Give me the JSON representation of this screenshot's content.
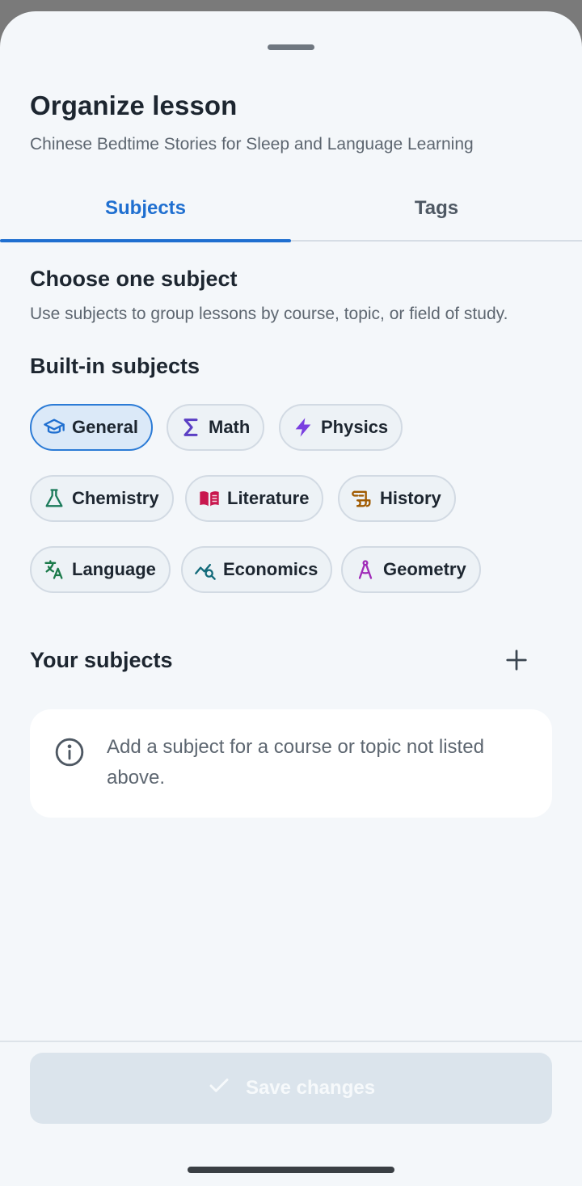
{
  "sheet": {
    "title": "Organize lesson",
    "subtitle": "Chinese Bedtime Stories for Sleep and Language Learning"
  },
  "tabs": [
    {
      "label": "Subjects",
      "active": true
    },
    {
      "label": "Tags",
      "active": false
    }
  ],
  "choose": {
    "title": "Choose one subject",
    "description": "Use subjects to group lessons by course, topic, or field of study."
  },
  "builtin": {
    "title": "Built-in subjects",
    "subjects": [
      {
        "label": "General",
        "icon": "graduation-cap-icon",
        "color": "#1f6fd0",
        "selected": true
      },
      {
        "label": "Math",
        "icon": "sigma-icon",
        "color": "#5b3fc4",
        "selected": false
      },
      {
        "label": "Physics",
        "icon": "lightning-icon",
        "color": "#7a3fe0",
        "selected": false
      },
      {
        "label": "Chemistry",
        "icon": "flask-icon",
        "color": "#1b7a5a",
        "selected": false
      },
      {
        "label": "Literature",
        "icon": "open-book-icon",
        "color": "#c8174e",
        "selected": false
      },
      {
        "label": "History",
        "icon": "scroll-icon",
        "color": "#a05a00",
        "selected": false
      },
      {
        "label": "Language",
        "icon": "translate-icon",
        "color": "#1b7a4a",
        "selected": false
      },
      {
        "label": "Economics",
        "icon": "trend-search-icon",
        "color": "#126a7a",
        "selected": false
      },
      {
        "label": "Geometry",
        "icon": "compass-icon",
        "color": "#a02ab8",
        "selected": false
      }
    ]
  },
  "yours": {
    "title": "Your subjects",
    "add_icon": "plus-icon",
    "empty_text": "Add a subject for a course or topic not listed above."
  },
  "footer": {
    "save_label": "Save changes",
    "save_enabled": false
  }
}
